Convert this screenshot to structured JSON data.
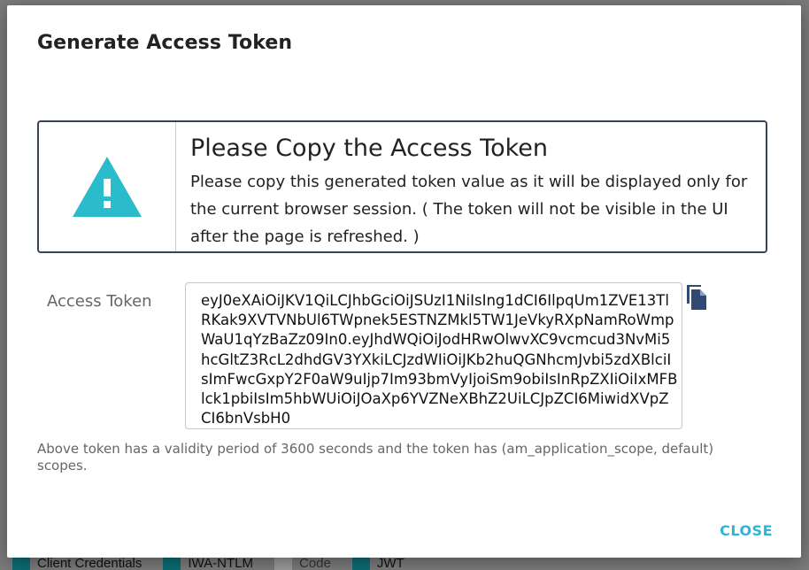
{
  "background": {
    "checkboxes": [
      {
        "label": "Client Credentials",
        "checked": true
      },
      {
        "label": "IWA-NTLM",
        "checked": true
      },
      {
        "label": "Code",
        "checked": false
      },
      {
        "label": "JWT",
        "checked": true
      }
    ]
  },
  "dialog": {
    "title": "Generate Access Token",
    "alert": {
      "icon": "warning-triangle-icon",
      "icon_color": "#2bbccb",
      "heading": "Please Copy the Access Token",
      "message": "Please copy this generated token value as it will be displayed only for the current browser session. ( The token will not be visible in the UI after the page is refreshed. )"
    },
    "token_field": {
      "label": "Access Token",
      "value": "eyJ0eXAiOiJKV1QiLCJhbGciOiJSUzI1NiIsIng1dCI6IlpqUm1ZVE13TlRKak9XVTVNbUl6TWpnek5ESTNZMkl5TW1JeVkyRXpNamRoWmpWaU1qYzBaZz09In0.eyJhdWQiOiJodHRwOlwvXC9vcmcud3NvMi5hcGltZ3RcL2dhdGV3YXkiLCJzdWIiOiJKb2huQGNhcmJvbi5zdXBlciIsImFwcGxpY2F0aW9uIjp7Im93bmVyIjoiSm9obiIsInRpZXIiOiIxMFBlck1pbiIsIm5hbWUiOiJOaXp6YVZNeXBhZ2UiLCJpZCI6MiwidXVpZCI6bnVsbH0"
    },
    "copy_icon": "copy-icon",
    "validity_note": "Above token has a validity period of 3600 seconds and the token has (am_application_scope, default) scopes.",
    "close_label": "CLOSE"
  },
  "colors": {
    "accent": "#29b6d8",
    "alert_border": "#39445a",
    "copy_icon": "#2f4a73"
  }
}
